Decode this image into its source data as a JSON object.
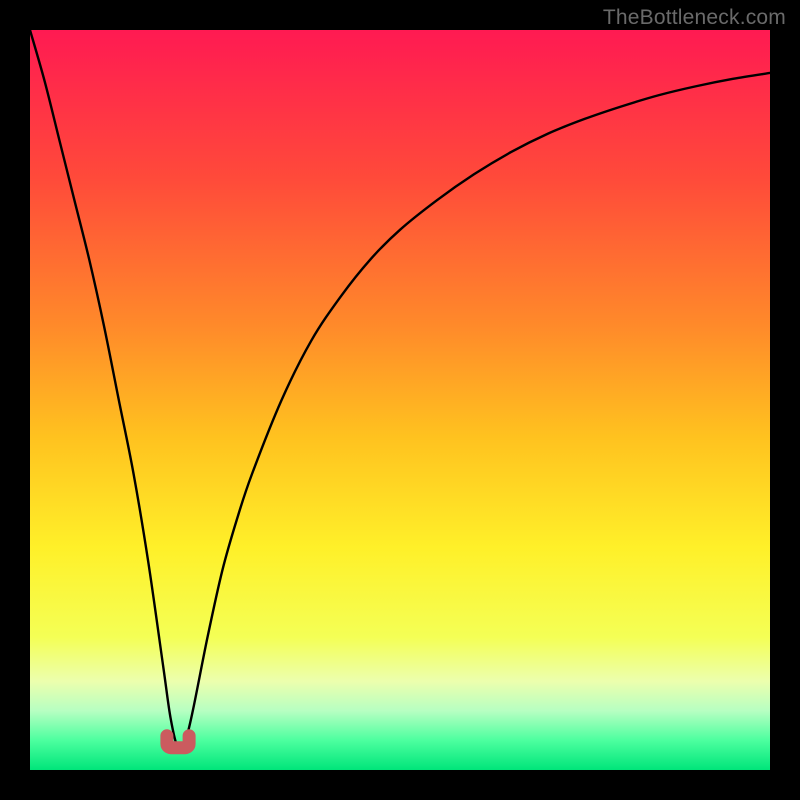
{
  "watermark": "TheBottleneck.com",
  "colors": {
    "background": "#000000",
    "watermark_text": "#6a6a6a",
    "curve": "#000000",
    "marker": "#cb5b5f",
    "gradient_stops": [
      {
        "offset": 0.0,
        "color": "#ff1a52"
      },
      {
        "offset": 0.2,
        "color": "#ff4a3a"
      },
      {
        "offset": 0.4,
        "color": "#ff8a2a"
      },
      {
        "offset": 0.55,
        "color": "#ffc21f"
      },
      {
        "offset": 0.7,
        "color": "#fff029"
      },
      {
        "offset": 0.82,
        "color": "#f4ff55"
      },
      {
        "offset": 0.88,
        "color": "#ecffad"
      },
      {
        "offset": 0.92,
        "color": "#b7ffc2"
      },
      {
        "offset": 0.96,
        "color": "#4cff9f"
      },
      {
        "offset": 1.0,
        "color": "#00e57a"
      }
    ]
  },
  "chart_data": {
    "type": "line",
    "title": "",
    "xlabel": "",
    "ylabel": "",
    "xlim": [
      0,
      100
    ],
    "ylim": [
      0,
      100
    ],
    "grid": false,
    "x": [
      0,
      2,
      4,
      6,
      8,
      10,
      12,
      14,
      16,
      18,
      19,
      20,
      21,
      22,
      24,
      26,
      28,
      30,
      34,
      38,
      42,
      46,
      50,
      55,
      60,
      65,
      70,
      75,
      80,
      85,
      90,
      95,
      100
    ],
    "values": [
      100,
      93,
      85,
      77,
      69,
      60,
      50,
      40,
      28,
      14,
      7,
      3,
      4,
      8,
      18,
      27,
      34,
      40,
      50,
      58,
      64,
      69,
      73,
      77,
      80.5,
      83.5,
      86,
      88,
      89.7,
      91.2,
      92.4,
      93.4,
      94.2
    ],
    "minimum_marker": {
      "x_range": [
        18.5,
        21.5
      ],
      "y": 3
    }
  }
}
